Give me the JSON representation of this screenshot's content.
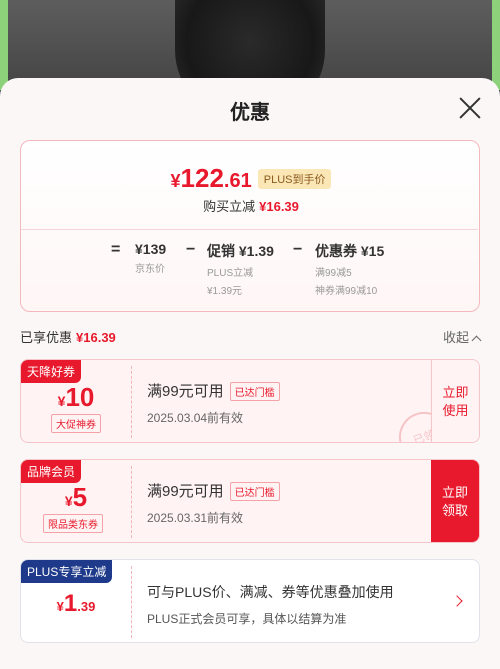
{
  "sheet": {
    "title": "优惠"
  },
  "summary": {
    "final_yen": "¥",
    "final_int": "122",
    "final_dec": ".61",
    "plus_label": "PLUS到手价",
    "reduce_label": "购买立减",
    "reduce_amount": "¥16.39"
  },
  "calc": {
    "eq": "=",
    "minus": "−",
    "jd_price": "¥139",
    "jd_label": "京东价",
    "promo_value": "促销 ¥1.39",
    "promo_sub1": "PLUS立减",
    "promo_sub2": "¥1.39元",
    "coupon_value": "优惠券 ¥15",
    "coupon_sub1": "满99减5",
    "coupon_sub2": "神券满99减10"
  },
  "enjoyed": {
    "label": "已享优惠",
    "amount": "¥16.39",
    "collapse": "收起"
  },
  "coupons": [
    {
      "tag": "天降好券",
      "yen": "¥",
      "amount": "10",
      "cond": "大促神券",
      "title": "满99元可用",
      "badge": "已达门槛",
      "date": "2025.03.04前有效",
      "action1": "立即",
      "action2": "使用",
      "stamp": "已领"
    },
    {
      "tag": "品牌会员",
      "yen": "¥",
      "amount": "5",
      "cond": "限品类东券",
      "title": "满99元可用",
      "badge": "已达门槛",
      "date": "2025.03.31前有效",
      "action1": "立即",
      "action2": "领取"
    }
  ],
  "plus_promo": {
    "tag": "PLUS专享立减",
    "yen": "¥",
    "int": "1",
    "dec": ".39",
    "line1": "可与PLUS价、满减、券等优惠叠加使用",
    "line2": "PLUS正式会员可享，具体以结算为准"
  },
  "colors": {
    "accent": "#e8192c",
    "plus_blue": "#1f3a8a",
    "gold_tag": "#fbe6b6"
  }
}
